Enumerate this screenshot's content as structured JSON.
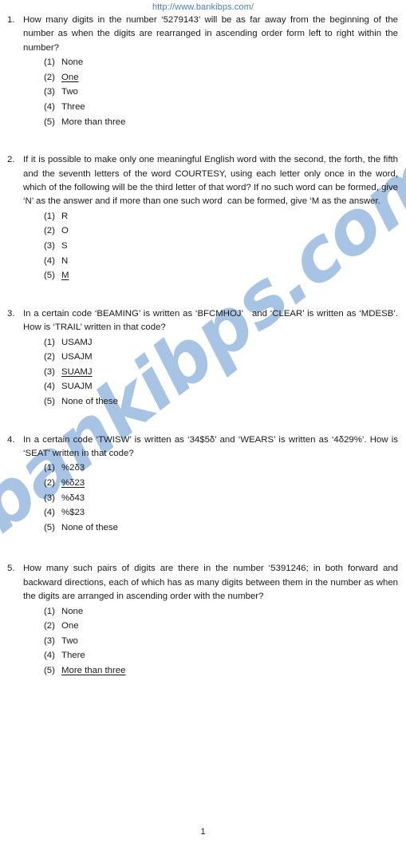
{
  "header": {
    "url": "http://www.bankibps.com/"
  },
  "watermark": {
    "text": "bankibps.com",
    "color": "#a8c4e5"
  },
  "questions": [
    {
      "number": "1.",
      "text": "How many digits in the number ‘5279143’ will be as far away from the beginning of the number as when the digits are rearranged in ascending order form left to right within the number?",
      "options": [
        {
          "marker": "(1)",
          "text": "None",
          "underlined": false
        },
        {
          "marker": "(2)",
          "text": "One",
          "underlined": true
        },
        {
          "marker": "(3)",
          "text": "Two",
          "underlined": false
        },
        {
          "marker": "(4)",
          "text": "Three",
          "underlined": false
        },
        {
          "marker": "(5)",
          "text": "More than three",
          "underlined": false
        }
      ]
    },
    {
      "number": "2.",
      "text": "If it is possible to make only one meaningful English word with the second, the forth, the fifth and the seventh letters of the word COURTESY, using each letter only once in the word, which of the following will be the third letter of that word? If no such word can be formed, give ‘N’ as the answer and if more than one such word  can be formed, give ‘M as the answer.",
      "options": [
        {
          "marker": "(1)",
          "text": "R",
          "underlined": false
        },
        {
          "marker": "(2)",
          "text": "O",
          "underlined": false
        },
        {
          "marker": "(3)",
          "text": "S",
          "underlined": false
        },
        {
          "marker": "(4)",
          "text": "N",
          "underlined": false
        },
        {
          "marker": "(5)",
          "text": "M",
          "underlined": true
        }
      ]
    },
    {
      "number": "3.",
      "text": "In a certain code ‘BEAMING’ is written as ‘BFCMHOJ’   and ‘CLEAR’ is written as ‘MDESB’. How is ‘TRAIL’ written in that code?",
      "options": [
        {
          "marker": "(1)",
          "text": "USAMJ",
          "underlined": false
        },
        {
          "marker": "(2)",
          "text": "USAJM",
          "underlined": false
        },
        {
          "marker": "(3)",
          "text": "SUAMJ",
          "underlined": true
        },
        {
          "marker": "(4)",
          "text": "SUAJM",
          "underlined": false
        },
        {
          "marker": "(5)",
          "text": "None of these",
          "underlined": false
        }
      ]
    },
    {
      "number": "4.",
      "text": "In a certain code ‘TWISW’ is written as ‘34$5δ’ and ‘WEARS’ is written as ‘4δ29%’. How is ‘SEAT’ written in that code?",
      "options": [
        {
          "marker": "(1)",
          "text": "%2δ3",
          "underlined": false
        },
        {
          "marker": "(2)",
          "text": "%δ23",
          "underlined": true
        },
        {
          "marker": "(3)",
          "text": "%δ43",
          "underlined": false
        },
        {
          "marker": "(4)",
          "text": "%$23",
          "underlined": false
        },
        {
          "marker": "(5)",
          "text": "None of these",
          "underlined": false
        }
      ]
    },
    {
      "number": "5.",
      "text": "How many such pairs of digits are there in the number ‘5391246; in both forward and backward directions, each of which has as many digits between them in the number as when the digits are arranged in ascending order with the number?",
      "options": [
        {
          "marker": "(1)",
          "text": "None",
          "underlined": false
        },
        {
          "marker": "(2)",
          "text": "One",
          "underlined": false
        },
        {
          "marker": "(3)",
          "text": "Two",
          "underlined": false
        },
        {
          "marker": "(4)",
          "text": "There",
          "underlined": false
        },
        {
          "marker": "(5)",
          "text": "More than three",
          "underlined": true
        }
      ]
    }
  ],
  "footer": {
    "page_number": "1"
  }
}
